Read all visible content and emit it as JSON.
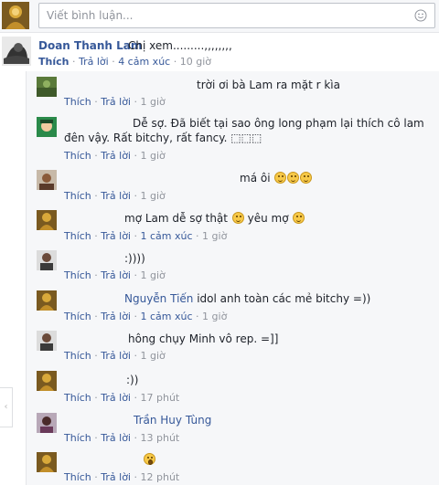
{
  "composer": {
    "placeholder": "Viết bình luận..."
  },
  "main_comment": {
    "author": "Doan Thanh Lam",
    "text": "Chị xem.........,,,,,,,,",
    "like": "Thích",
    "sep": "·",
    "reply": "Trả lời",
    "reactions": "4 cảm xúc",
    "time": "10 giờ"
  },
  "replies": [
    {
      "text": "trời ơi bà Lam ra mặt r kìa",
      "like": "Thích",
      "reply": "Trả lời",
      "reactions": "",
      "time": "1 giờ"
    },
    {
      "text": "Dễ sợ. Đã biết tại sao ông long phạm lại thích cô lam",
      "text2": "đên vậy. Rất bitchy, rất fancy. ⬚⬚⬚",
      "like": "Thích",
      "reply": "Trả lời",
      "reactions": "",
      "time": "1 giờ"
    },
    {
      "text": "má ôi",
      "like": "Thích",
      "reply": "Trả lời",
      "reactions": "",
      "time": "1 giờ"
    },
    {
      "text": "mợ Lam dễ sợ thật",
      "text_b": "yêu mợ",
      "like": "Thích",
      "reply": "Trả lời",
      "reactions": "1 cảm xúc",
      "time": "1 giờ"
    },
    {
      "text": ":))))",
      "like": "Thích",
      "reply": "Trả lời",
      "reactions": "",
      "time": "1 giờ"
    },
    {
      "mention": "Nguyễn Tiến",
      "text": "idol anh toàn các mẻ bitchy =))",
      "like": "Thích",
      "reply": "Trả lời",
      "reactions": "1 cảm xúc",
      "time": "1 giờ"
    },
    {
      "text": "hông chụy Minh vô rep. =]]",
      "like": "Thích",
      "reply": "Trả lời",
      "reactions": "",
      "time": "1 giờ"
    },
    {
      "text": ":))",
      "like": "Thích",
      "reply": "Trả lời",
      "reactions": "",
      "time": "17 phút"
    },
    {
      "mention": "Trần Huy Tùng",
      "like": "Thích",
      "reply": "Trả lời",
      "reactions": "",
      "time": "13 phút"
    },
    {
      "like": "Thích",
      "reply": "Trả lời",
      "reactions": "",
      "time": "12 phút"
    }
  ],
  "colors": {
    "link": "#365899",
    "meta": "#90949c",
    "text": "#1d2129",
    "panel": "#f6f7f9"
  }
}
